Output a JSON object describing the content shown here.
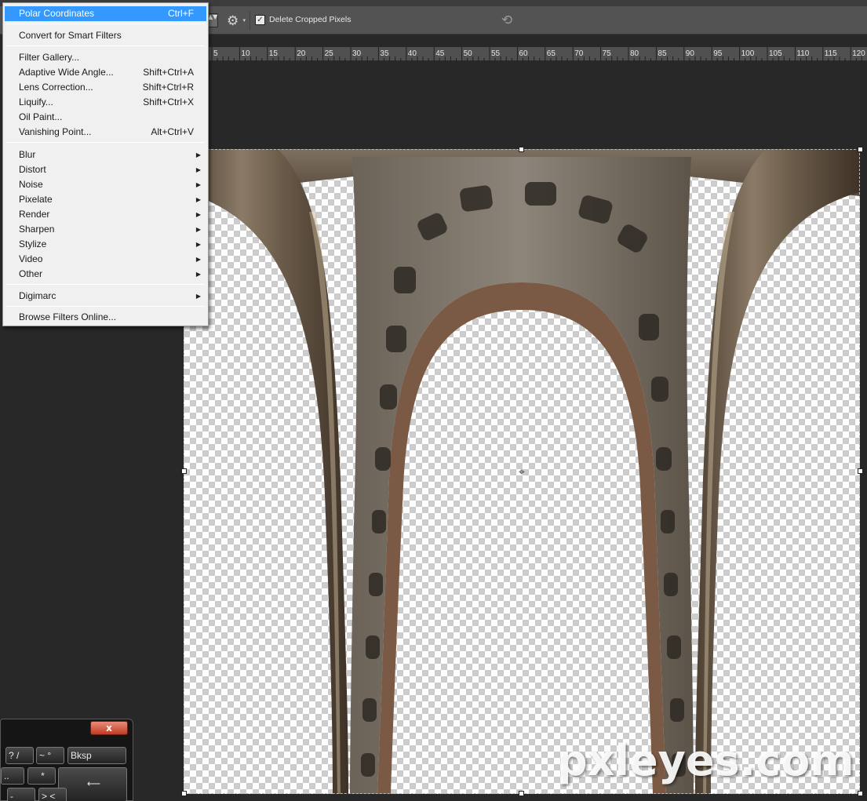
{
  "options_bar": {
    "spinner_glyph": "▲▼",
    "gear_icon": "gear-icon",
    "checkbox_checked": true,
    "checkbox_mark": "✓",
    "delete_cropped_label": "Delete Cropped Pixels",
    "reset_icon": "rotate-reset-icon"
  },
  "ruler": {
    "labels": [
      "5",
      "10",
      "15",
      "20",
      "25",
      "30",
      "35",
      "40",
      "45",
      "50",
      "55",
      "60",
      "65",
      "70",
      "75",
      "80",
      "85",
      "90",
      "95",
      "100",
      "105",
      "110",
      "115",
      "120"
    ]
  },
  "filter_menu": {
    "polar_coordinates": {
      "label": "Polar Coordinates",
      "shortcut": "Ctrl+F"
    },
    "convert_smart": {
      "label": "Convert for Smart Filters"
    },
    "filter_gallery": {
      "label": "Filter Gallery..."
    },
    "adaptive_wide": {
      "label": "Adaptive Wide Angle...",
      "shortcut": "Shift+Ctrl+A"
    },
    "lens_correction": {
      "label": "Lens Correction...",
      "shortcut": "Shift+Ctrl+R"
    },
    "liquify": {
      "label": "Liquify...",
      "shortcut": "Shift+Ctrl+X"
    },
    "oil_paint": {
      "label": "Oil Paint..."
    },
    "vanishing_point": {
      "label": "Vanishing Point...",
      "shortcut": "Alt+Ctrl+V"
    },
    "blur": {
      "label": "Blur"
    },
    "distort": {
      "label": "Distort"
    },
    "noise": {
      "label": "Noise"
    },
    "pixelate": {
      "label": "Pixelate"
    },
    "render": {
      "label": "Render"
    },
    "sharpen": {
      "label": "Sharpen"
    },
    "stylize": {
      "label": "Stylize"
    },
    "video": {
      "label": "Video"
    },
    "other": {
      "label": "Other"
    },
    "digimarc": {
      "label": "Digimarc"
    },
    "browse_online": {
      "label": "Browse Filters Online..."
    },
    "submenu_arrow": "▶"
  },
  "osk": {
    "close_label": "x",
    "keys": {
      "question_slash": "? /",
      "tilde": "~ °",
      "bksp": "Bksp",
      "dots": "..",
      "asterisk": "*",
      "enter": "⟵",
      "minus": "-",
      "greater": "> <"
    }
  },
  "watermark": "pxleyes.com",
  "canvas": {
    "center_marker_glyph": "⌖"
  }
}
